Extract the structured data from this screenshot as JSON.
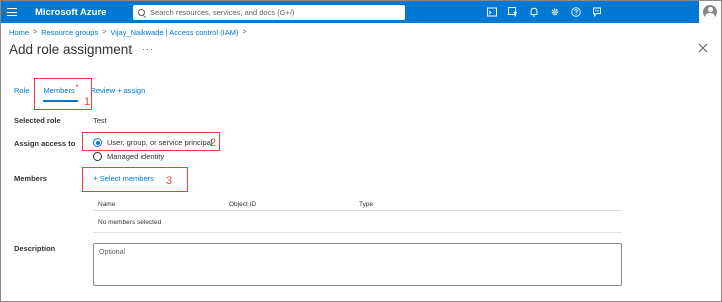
{
  "topbar": {
    "brand": "Microsoft Azure",
    "search_placeholder": "Search resources, services, and docs (G+/)",
    "icons": [
      "cloud-shell-icon",
      "directory-filter-icon",
      "notifications-icon",
      "settings-icon",
      "help-icon",
      "feedback-icon"
    ],
    "accent": "#0078d4"
  },
  "breadcrumb": {
    "items": [
      "Home",
      "Resource groups",
      "Vijay_Naikwade | Access control (IAM)"
    ],
    "separator": ">"
  },
  "page": {
    "title": "Add role assignment",
    "more": "···"
  },
  "tabs": {
    "role": "Role",
    "members": "Members",
    "members_required": "*",
    "review": "Review + assign"
  },
  "annotations": {
    "n1": "1",
    "n2": "2",
    "n3": "3",
    "color": "#e8413c"
  },
  "form": {
    "selected_role_label": "Selected role",
    "selected_role_value": "Test",
    "assign_access_label": "Assign access to",
    "option_user": "User, group, or service principal",
    "option_managed": "Managed identity",
    "selected_option": "User, group, or service principal",
    "members_label": "Members",
    "select_members": "Select members",
    "plus": "+",
    "description_label": "Description",
    "description_placeholder": "Optional"
  },
  "table": {
    "columns": [
      "Name",
      "Object ID",
      "Type"
    ],
    "empty_text": "No members selected"
  }
}
